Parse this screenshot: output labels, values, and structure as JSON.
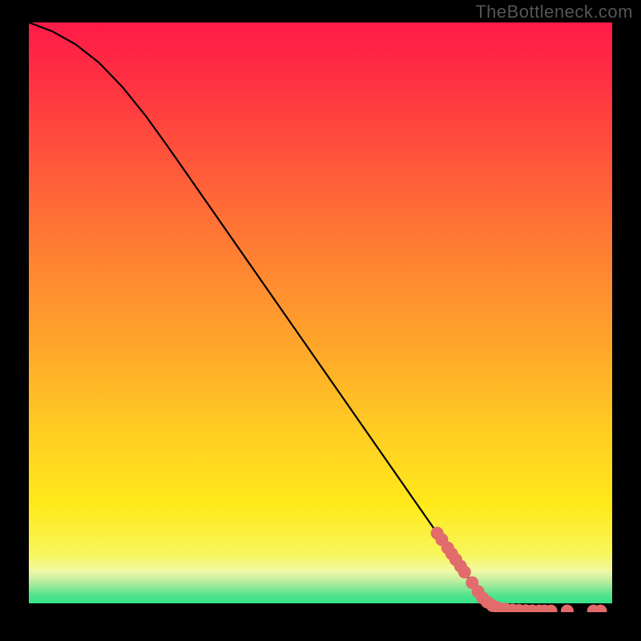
{
  "watermark": "TheBottleneck.com",
  "chart_data": {
    "type": "line",
    "title": "",
    "xlabel": "",
    "ylabel": "",
    "xlim": [
      0,
      100
    ],
    "ylim": [
      0,
      100
    ],
    "background_gradient": {
      "top_color": "#ff1a48",
      "mid_color": "#ffe000",
      "green_band_color": "#35e38a",
      "bottom_color": "#000000"
    },
    "curve": {
      "x": [
        0,
        4,
        8,
        12,
        16,
        20,
        24,
        30,
        40,
        50,
        60,
        70,
        78,
        82,
        85,
        88,
        90,
        93,
        96,
        100
      ],
      "y": [
        100,
        98.5,
        96.3,
        93.2,
        89.1,
        84.2,
        78.7,
        70.2,
        56.0,
        41.8,
        27.6,
        13.4,
        2.1,
        0.6,
        0.25,
        0.2,
        0.2,
        0.2,
        0.2,
        0.2
      ],
      "color": "#000000"
    },
    "markers": {
      "color": "#e26b6b",
      "radius_pct": 1.1,
      "points": [
        {
          "x": 70.0,
          "y": 13.4
        },
        {
          "x": 70.8,
          "y": 12.3
        },
        {
          "x": 71.8,
          "y": 10.9
        },
        {
          "x": 72.5,
          "y": 9.9
        },
        {
          "x": 73.2,
          "y": 8.9
        },
        {
          "x": 74.0,
          "y": 7.8
        },
        {
          "x": 74.7,
          "y": 6.8
        },
        {
          "x": 76.0,
          "y": 5.0
        },
        {
          "x": 77.0,
          "y": 3.5
        },
        {
          "x": 77.8,
          "y": 2.4
        },
        {
          "x": 78.6,
          "y": 1.7
        },
        {
          "x": 79.5,
          "y": 1.1
        },
        {
          "x": 80.5,
          "y": 0.7
        },
        {
          "x": 81.7,
          "y": 0.5
        },
        {
          "x": 82.9,
          "y": 0.35
        },
        {
          "x": 84.0,
          "y": 0.3
        },
        {
          "x": 85.2,
          "y": 0.25
        },
        {
          "x": 86.3,
          "y": 0.22
        },
        {
          "x": 87.5,
          "y": 0.2
        },
        {
          "x": 88.4,
          "y": 0.2
        },
        {
          "x": 89.5,
          "y": 0.2
        },
        {
          "x": 92.3,
          "y": 0.2
        },
        {
          "x": 96.8,
          "y": 0.2
        },
        {
          "x": 98.0,
          "y": 0.2
        }
      ]
    }
  }
}
